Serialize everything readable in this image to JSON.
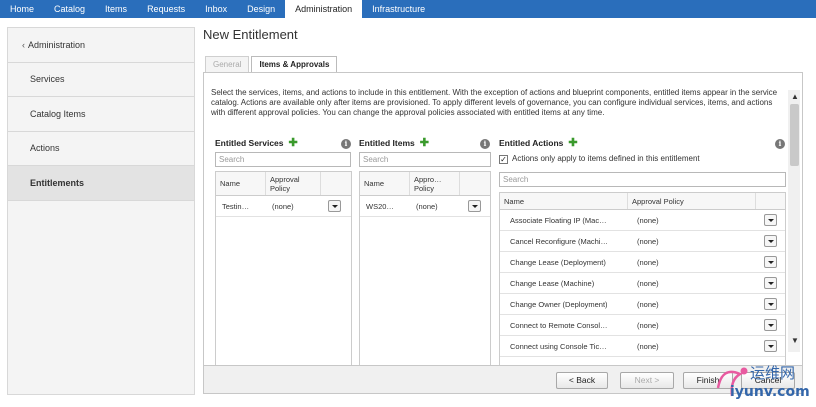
{
  "topnav": {
    "tabs": [
      "Home",
      "Catalog",
      "Items",
      "Requests",
      "Inbox",
      "Design",
      "Administration",
      "Infrastructure"
    ]
  },
  "sidebar": {
    "items": [
      {
        "label": "Administration"
      },
      {
        "label": "Services"
      },
      {
        "label": "Catalog Items"
      },
      {
        "label": "Actions"
      },
      {
        "label": "Entitlements"
      }
    ]
  },
  "page": {
    "title": "New Entitlement",
    "tabs": {
      "general": "General",
      "items_approvals": "Items & Approvals"
    },
    "intro": "Select the services, items, and actions to include in this entitlement. With the exception of actions and blueprint components, entitled items appear in the service catalog. Actions are available only after items are provisioned. To apply different levels of governance, you can configure individual services, items, and actions with different approval policies. You can change the approval policies associated with entitled items at any time."
  },
  "services": {
    "title": "Entitled Services",
    "search_placeholder": "Search",
    "headers": {
      "name": "Name",
      "policy": "Approval Policy"
    },
    "rows": [
      {
        "name": "Testin…",
        "policy": "(none)"
      }
    ]
  },
  "items": {
    "title": "Entitled Items",
    "search_placeholder": "Search",
    "headers": {
      "name": "Name",
      "policy": "Appro… Policy"
    },
    "rows": [
      {
        "name": "WS20…",
        "policy": "(none)"
      }
    ]
  },
  "actions": {
    "title": "Entitled Actions",
    "checkbox_label": "Actions only apply to items defined in this entitlement",
    "checkbox_checked": true,
    "search_placeholder": "Search",
    "headers": {
      "name": "Name",
      "policy": "Approval Policy"
    },
    "rows": [
      {
        "name": "Associate Floating IP (Mac…",
        "policy": "(none)"
      },
      {
        "name": "Cancel Reconfigure (Machi…",
        "policy": "(none)"
      },
      {
        "name": "Change Lease (Deployment)",
        "policy": "(none)"
      },
      {
        "name": "Change Lease (Machine)",
        "policy": "(none)"
      },
      {
        "name": "Change Owner (Deployment)",
        "policy": "(none)"
      },
      {
        "name": "Connect to Remote Consol…",
        "policy": "(none)"
      },
      {
        "name": "Connect using Console Tic…",
        "policy": "(none)"
      }
    ]
  },
  "footer": {
    "back": "< Back",
    "next": "Next >",
    "finish": "Finish",
    "cancel": "Cancel"
  },
  "watermark": {
    "cn": "运维网",
    "url": "iyunv.com"
  },
  "colors": {
    "nav": "#2a6ebb",
    "plus": "#3a9a2c"
  }
}
